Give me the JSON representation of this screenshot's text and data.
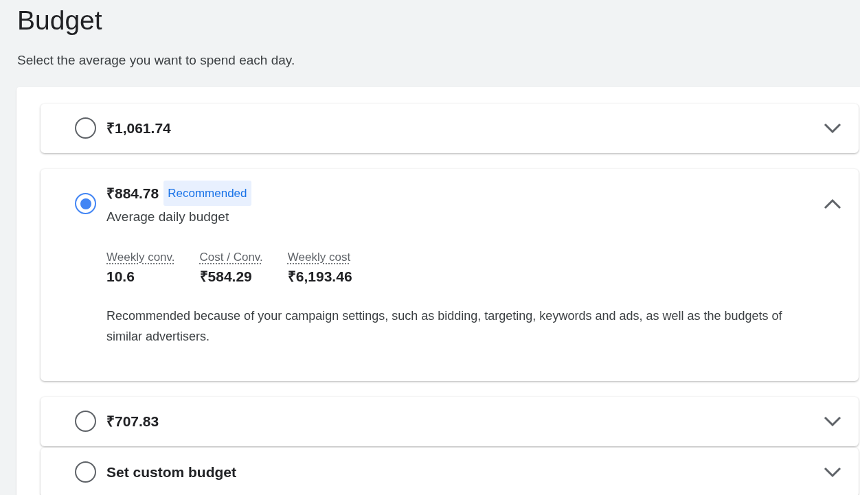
{
  "title": "Budget",
  "subtitle": "Select the average you want to spend each day.",
  "options": [
    {
      "label": "₹1,061.74",
      "selected": false,
      "expanded": false
    },
    {
      "label": "₹884.78",
      "badge": "Recommended",
      "caption": "Average daily budget",
      "selected": true,
      "expanded": true,
      "metrics": [
        {
          "name": "Weekly conv.",
          "value": "10.6"
        },
        {
          "name": "Cost / Conv.",
          "value": "₹584.29"
        },
        {
          "name": "Weekly cost",
          "value": "₹6,193.46"
        }
      ],
      "note": "Recommended because of your campaign settings, such as bidding, targeting, keywords and ads, as well as the budgets of similar advertisers."
    },
    {
      "label": "₹707.83",
      "selected": false,
      "expanded": false
    },
    {
      "label": "Set custom budget",
      "selected": false,
      "expanded": false
    }
  ]
}
